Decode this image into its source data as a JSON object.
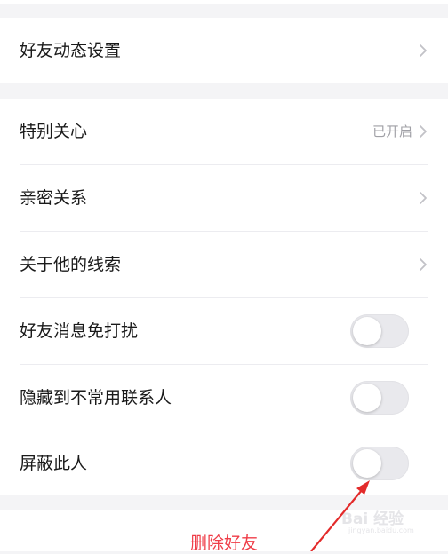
{
  "section1": {
    "item": {
      "label": "好友动态设置"
    }
  },
  "section2": {
    "items": [
      {
        "label": "特别关心",
        "value": "已开启"
      },
      {
        "label": "亲密关系"
      },
      {
        "label": "关于他的线索"
      },
      {
        "label": "好友消息免打扰"
      },
      {
        "label": "隐藏到不常用联系人"
      },
      {
        "label": "屏蔽此人"
      }
    ]
  },
  "delete_button": {
    "label": "删除好友"
  },
  "watermark": {
    "text": "Bai 经验",
    "sub": "jingyan.baidu.com"
  },
  "colors": {
    "delete": "#ef3d48",
    "annotation_arrow": "#e32a2a",
    "background": "#f4f4f6"
  }
}
